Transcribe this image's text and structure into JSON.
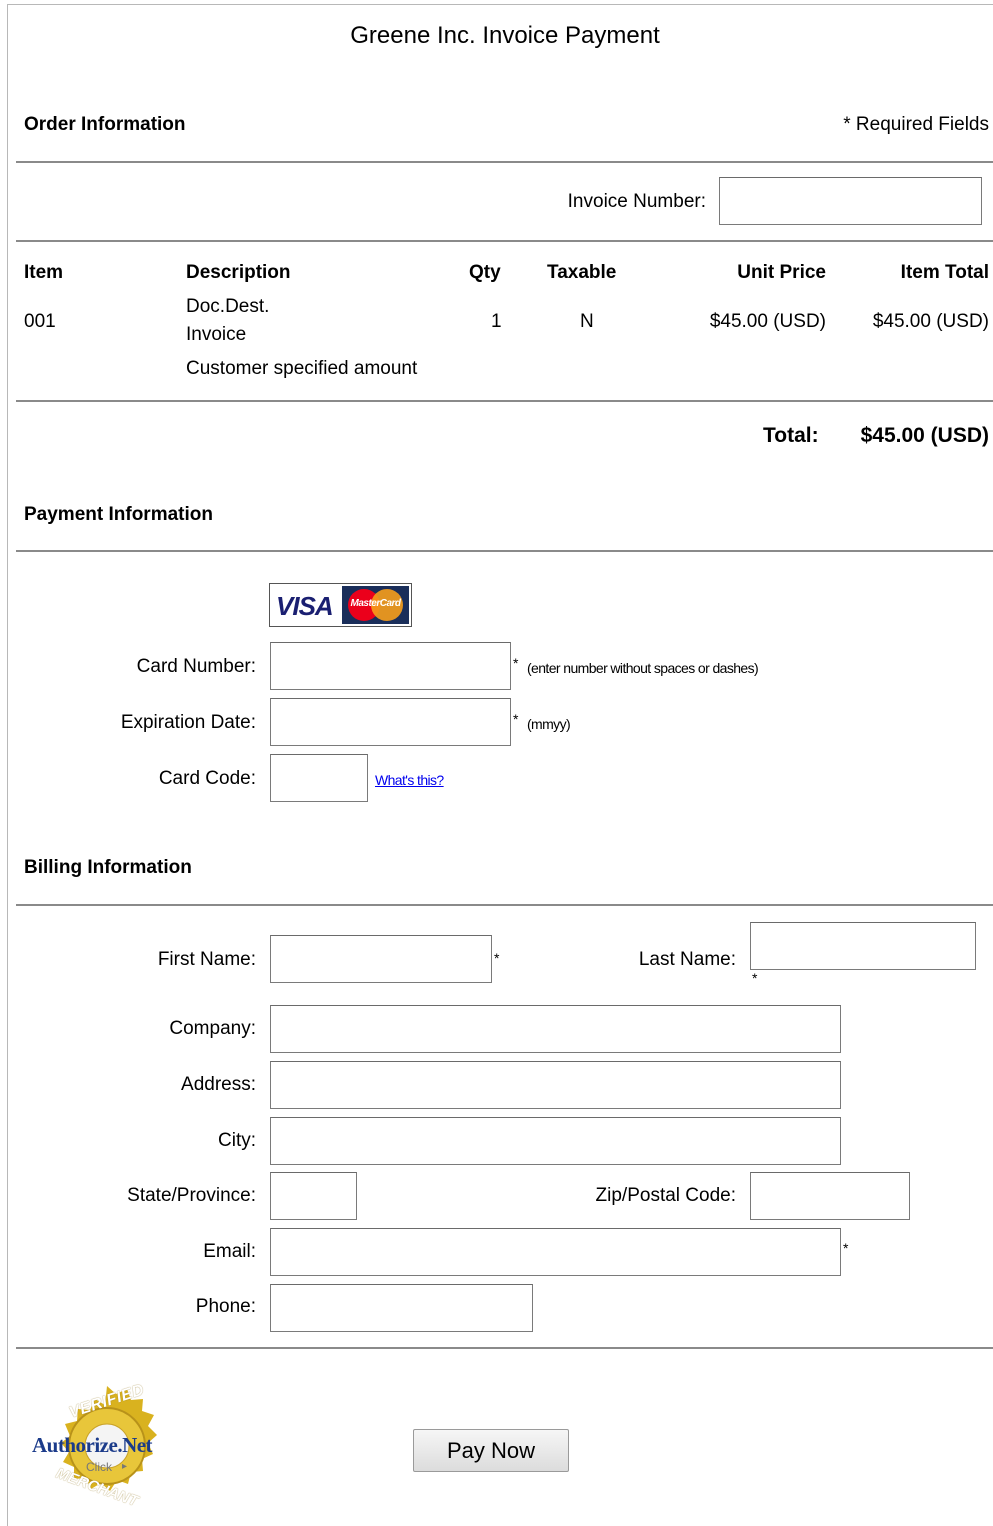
{
  "page": {
    "title": "Greene Inc. Invoice Payment"
  },
  "order": {
    "heading": "Order Information",
    "required_note": "* Required Fields",
    "invoice_label": "Invoice Number:",
    "invoice_value": "",
    "columns": {
      "item": "Item",
      "description": "Description",
      "qty": "Qty",
      "taxable": "Taxable",
      "unit_price": "Unit Price",
      "item_total": "Item Total"
    },
    "row": {
      "item": "001",
      "desc_line1": "Doc.Dest.",
      "desc_line2": "Invoice",
      "qty": "1",
      "taxable": "N",
      "unit_price": "$45.00 (USD)",
      "item_total": "$45.00 (USD)",
      "note": "Customer specified amount"
    },
    "total_label": "Total:",
    "total_value": "$45.00 (USD)"
  },
  "payment": {
    "heading": "Payment Information",
    "card_logo_visa": "VISA",
    "card_logo_mc": "MasterCard",
    "card_number_label": "Card Number:",
    "card_number_hint": "(enter number without spaces or dashes)",
    "exp_label": "Expiration Date:",
    "exp_hint": "(mmyy)",
    "code_label": "Card Code:",
    "whats_this": "What's this?",
    "required_star": "*"
  },
  "billing": {
    "heading": "Billing Information",
    "first_name_label": "First Name:",
    "last_name_label": "Last Name:",
    "company_label": "Company:",
    "address_label": "Address:",
    "city_label": "City:",
    "state_label": "State/Province:",
    "zip_label": "Zip/Postal Code:",
    "email_label": "Email:",
    "phone_label": "Phone:",
    "required_star": "*"
  },
  "footer": {
    "pay_button": "Pay Now",
    "seal_top": "VERIFIED",
    "seal_brand": "Authorize.Net",
    "seal_click": "Click",
    "seal_bottom": "MERCHANT"
  },
  "colors": {
    "link": "#0000ee",
    "rule": "#8a8a8a",
    "seal_gold": "#d9b21f",
    "visa_blue": "#1a1f71",
    "mc_red": "#eb001b",
    "mc_orange": "#f79e1b"
  }
}
